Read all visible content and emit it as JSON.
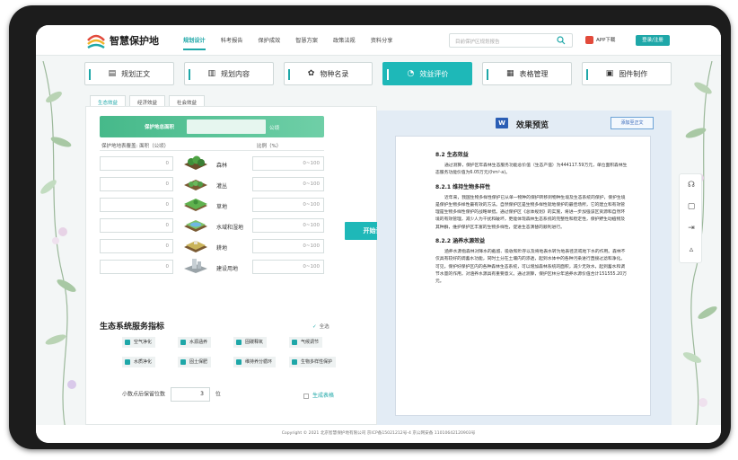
{
  "header": {
    "title": "智慧保护地",
    "nav": [
      "规划设计",
      "科考报告",
      "保护成效",
      "智慧方案",
      "政策法规",
      "资料分享"
    ],
    "search_placeholder": "目前保护区规划报告",
    "app_download": "APP下载",
    "login": "登录/注册"
  },
  "main_tabs": [
    {
      "label": "规划正文",
      "icon": "document-icon"
    },
    {
      "label": "规划内容",
      "icon": "list-icon"
    },
    {
      "label": "物种名录",
      "icon": "flower-icon"
    },
    {
      "label": "效益评价",
      "icon": "chart-icon",
      "active": true
    },
    {
      "label": "表格管理",
      "icon": "table-icon"
    },
    {
      "label": "图件制作",
      "icon": "image-icon"
    }
  ],
  "sub_tabs": [
    "生态效益",
    "经济效益",
    "社会效益"
  ],
  "area": {
    "label": "保护地总面积",
    "unit": "公顷"
  },
  "columns": {
    "area_col": "保护地地表覆盖: 面积（公顷）",
    "ratio_col": "比例（%）"
  },
  "land_types": [
    {
      "name": "森林",
      "value": "0",
      "ratio": "0~100"
    },
    {
      "name": "灌丛",
      "value": "0",
      "ratio": "0~100"
    },
    {
      "name": "草地",
      "value": "0",
      "ratio": "0~100"
    },
    {
      "name": "水域和湿地",
      "value": "0",
      "ratio": "0~100"
    },
    {
      "name": "耕地",
      "value": "0",
      "ratio": "0~100"
    },
    {
      "name": "建设用地",
      "value": "0",
      "ratio": "0~100"
    }
  ],
  "services": {
    "title": "生态系统服务指标",
    "select_all": "全选",
    "items": [
      "空气净化",
      "水源涵养",
      "固碳释氧",
      "气候调节",
      "水质净化",
      "固土保肥",
      "维持养分循环",
      "生物多样性保护"
    ]
  },
  "decimals": {
    "label": "小数点后保留位数",
    "value": "3",
    "unit": "位"
  },
  "generate_table": "生成表格",
  "calc_button": "开始计算",
  "preview": {
    "title": "效果预览",
    "add_button": "添加至正文",
    "doc": [
      {
        "type": "h",
        "text": "8.2 生态效益"
      },
      {
        "type": "p",
        "text": "通过测算，保护区年森林生态服务功能总价值（生态产值）为444117.59万元，单位面积森林生态服务功能价值为6.05万元/(hm²·a)。"
      },
      {
        "type": "h",
        "text": "8.2.1 维持生物多样性"
      },
      {
        "type": "p",
        "text": "近年来，我国生物多样性保护已从单一物种的保护转移到物种生境及生态系统的保护，保护生境是保护生物多样性最有效的方法。自然保护区是生物多样性就地保护的最佳场所，它的建立和有效管理是生物多样性保护的战略举措。通过保护区《总体规划》的实施，将进一步加强该区资源和自然环境的有效管理，减少人为干扰和破坏，更能体现森林生态系统的完整性和稳定性，保护野生动植物及其种群，维护保护区丰富的生物多样性，促进生态演替的顺利进行。"
      },
      {
        "type": "h",
        "text": "8.2.2 涵养水源效益"
      },
      {
        "type": "p",
        "text": "涵养水源指森林对降水的截留、吸收和贮存以及将地表水转为地表径流或地下水的作用。森林不仅具有较好的调蓄水功能，同时土分在土壤内的渗透，起到水体中的各种污染进行直接过滤和净化。可见，保护好保护区内的各种森林生态系统，可以增加森林系统的面积，减少无效水，起到蓄水和调节水量的作用，对涵养水源具有重要意义。通过测算，保护区林分年涵养水源价值合计151555.20万元。"
      }
    ]
  },
  "footer": "Copyright © 2021 北京智慧保护地有限公司 京ICP备15021212号-4 京公网安备 11010642120903号"
}
